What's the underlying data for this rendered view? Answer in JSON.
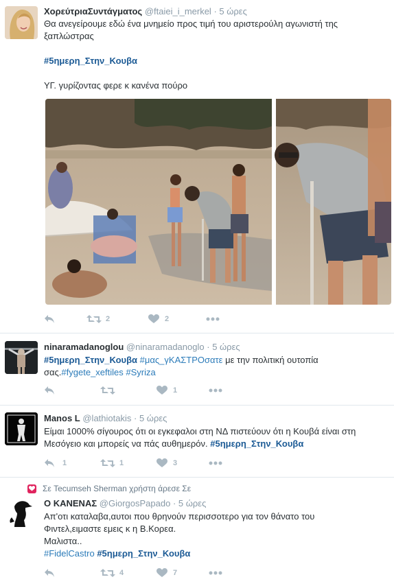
{
  "tweets": [
    {
      "name": "ΧορεύτριαΣυντάγματος",
      "handle": "@ftaiei_i_merkel",
      "time": "5 ώρες",
      "text1": "Θα ανεγείρουμε εδώ ένα μνημείο προς τιμή του αριστερούλη αγωνιστή της ξαπλώστρας",
      "hashtag": "#5ημερη_Στην_Κουβα",
      "text2": "ΥΓ. γυρίζοντας φερε κ κανένα πούρο",
      "retweets": "2",
      "likes": "2"
    },
    {
      "name": "ninaramadanoglou",
      "handle": "@ninaramadanoglo",
      "time": "5 ώρες",
      "hashtag1": "#5ημερη_Στην_Κουβα",
      "hashtag2": "#μας_γΚΑΣΤΡΟσατε",
      "text1": " με την πολιτική ουτοπία",
      "text2": "σας.",
      "hashtag3": "#fygete_xeftiles",
      "hashtag4": "#Syriza",
      "retweets": "",
      "likes": "1"
    },
    {
      "name": "Manos L",
      "handle": "@lathiotakis",
      "time": "5 ώρες",
      "text1": "Είμαι 1000% σίγουρος ότι οι εγκεφαλοι στη ΝΔ πιστεύουν ότι η Κουβά είναι στη Μεσόγειο και μπορείς να πάς αυθημερόν.",
      "hashtag": "#5ημερη_Στην_Κουβα",
      "replies": "1",
      "retweets": "1",
      "likes": "3"
    },
    {
      "context": "Σε Tecumseh Sherman χρήστη άρεσε Σε",
      "name": "Ο ΚΑΝΕΝΑΣ",
      "handle": "@GiorgosPapado",
      "time": "5 ώρες",
      "text1": "Απ'οτι καταλαβα,αυτοι που θρηνούν περισσοτερο για τον θάνατο του",
      "text2": "Φιντελ,ειμαστε εμεις κ η Β.Κορεα.",
      "text3": "Μαλιστα..",
      "hashtag1": "#FidelCastro",
      "hashtag2": "#5ημερη_Στην_Κουβα",
      "retweets": "4",
      "likes": "7"
    }
  ],
  "colors": {
    "link": "#2b7bb9",
    "muted": "#8899a6",
    "icon": "#aab8c2",
    "like_badge": "#e0245e"
  }
}
